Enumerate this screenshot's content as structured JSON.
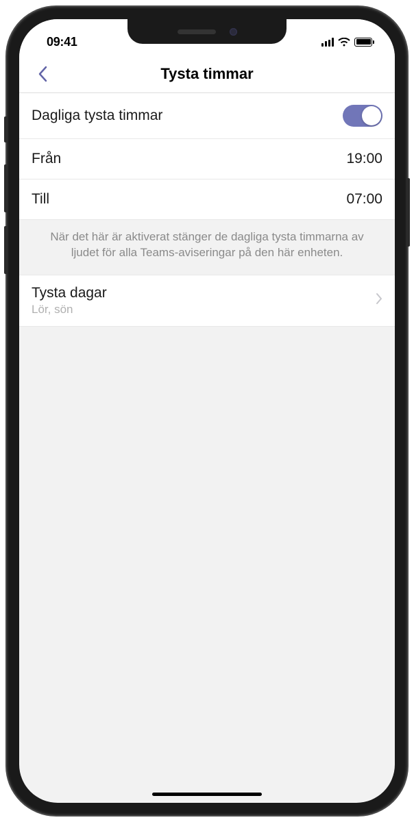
{
  "statusBar": {
    "time": "09:41"
  },
  "header": {
    "title": "Tysta timmar"
  },
  "dailyQuietHours": {
    "label": "Dagliga tysta timmar",
    "enabled": true
  },
  "from": {
    "label": "Från",
    "value": "19:00"
  },
  "to": {
    "label": "Till",
    "value": "07:00"
  },
  "description": "När det här är aktiverat stänger de dagliga tysta timmarna av ljudet för alla Teams-aviseringar på den här enheten.",
  "quietDays": {
    "label": "Tysta dagar",
    "value": "Lör, sön"
  },
  "colors": {
    "toggleOn": "#7176b8"
  }
}
